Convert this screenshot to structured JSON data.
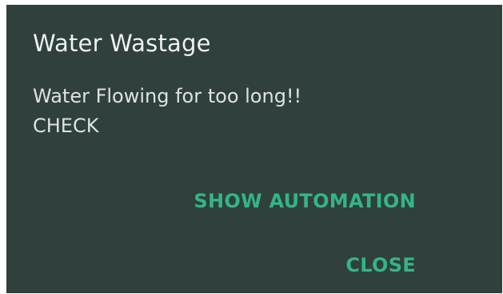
{
  "dialog": {
    "title": "Water Wastage",
    "message": "Water Flowing for too long!! CHECK",
    "actions": {
      "show_automation_label": "SHOW AUTOMATION",
      "close_label": "CLOSE"
    }
  },
  "colors": {
    "dialog_background": "#2f403d",
    "title_text": "#eef1f0",
    "body_text": "#dde2e1",
    "accent": "#34b487"
  }
}
